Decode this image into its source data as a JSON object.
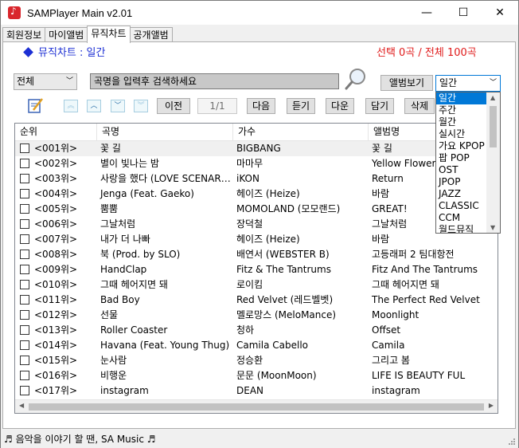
{
  "window": {
    "title": "SAMPlayer Main v2.01",
    "minimize": "—",
    "maximize": "☐",
    "close": "✕"
  },
  "tabs": [
    {
      "label": "회원정보"
    },
    {
      "label": "마이앨범"
    },
    {
      "label": "뮤직차트"
    },
    {
      "label": "공개앨범"
    }
  ],
  "header": {
    "title": "뮤직차트 : 일간",
    "count": "선택 0곡 / 전체 100곡"
  },
  "filter": {
    "category": "전체",
    "search_value": "곡명을 입력후 검색하세요",
    "album_view": "앨범보기",
    "period": "일간"
  },
  "toolbar": {
    "prev": "이전",
    "page": "1/1",
    "next": "다음",
    "listen": "듣기",
    "download": "다운",
    "add": "담기",
    "delete": "삭제"
  },
  "table": {
    "columns": [
      "순위",
      "곡명",
      "가수",
      "앨범명"
    ],
    "rows": [
      [
        "<001위>",
        "꽃 길",
        "BIGBANG",
        "꽃 길"
      ],
      [
        "<002위>",
        "별이 빛나는 밤",
        "마마무",
        "Yellow Flower"
      ],
      [
        "<003위>",
        "사랑을 했다 (LOVE SCENARIO)",
        "iKON",
        "Return"
      ],
      [
        "<004위>",
        "Jenga (Feat. Gaeko)",
        "헤이즈 (Heize)",
        "바람"
      ],
      [
        "<005위>",
        "뿜뿜",
        "MOMOLAND (모모랜드)",
        "GREAT!"
      ],
      [
        "<006위>",
        "그날처럼",
        "장덕철",
        "그날처럼"
      ],
      [
        "<007위>",
        "내가 더 나빠",
        "헤이즈 (Heize)",
        "바람"
      ],
      [
        "<008위>",
        "북 (Prod. by SLO)",
        "배연서 (WEBSTER B)",
        "고등래퍼 2 팀대항전"
      ],
      [
        "<009위>",
        "HandClap",
        "Fitz & The Tantrums",
        "Fitz And The Tantrums"
      ],
      [
        "<010위>",
        "그때 헤어지면 돼",
        "로이킴",
        "그때 헤어지면 돼"
      ],
      [
        "<011위>",
        "Bad Boy",
        "Red Velvet (레드벨벳)",
        "The Perfect Red Velvet"
      ],
      [
        "<012위>",
        "선물",
        "멜로망스 (MeloMance)",
        "Moonlight"
      ],
      [
        "<013위>",
        "Roller Coaster",
        "청하",
        "Offset"
      ],
      [
        "<014위>",
        "Havana (Feat. Young Thug)",
        "Camila Cabello",
        "Camila"
      ],
      [
        "<015위>",
        "눈사람",
        "정승환",
        "그리고 봄"
      ],
      [
        "<016위>",
        "비행운",
        "문문 (MoonMoon)",
        "LIFE IS BEAUTY FUL"
      ],
      [
        "<017위>",
        "instagram",
        "DEAN",
        "instagram"
      ]
    ]
  },
  "period_options": [
    "일간",
    "주간",
    "월간",
    "실시간",
    "가요 KPOP",
    "팝 POP",
    "OST",
    "JPOP",
    "JAZZ",
    "CLASSIC",
    "CCM",
    "월드뮤직"
  ],
  "status": {
    "text": "♬ 음악을 이야기 할 땐, SA Music ♬"
  },
  "colors": {
    "accent": "#1c2fd4",
    "count_red": "#e01b1b",
    "selected": "#0078d7"
  }
}
